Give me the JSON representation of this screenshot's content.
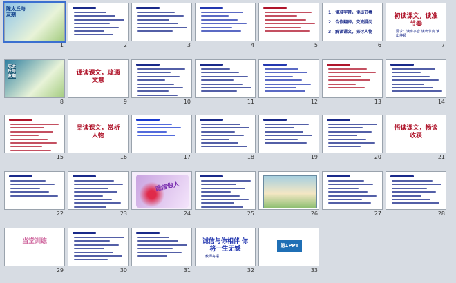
{
  "slides": [
    {
      "n": "1",
      "kind": "cover",
      "title": "陈太丘与友期",
      "bg": "#8fc3e8"
    },
    {
      "n": "2",
      "kind": "text",
      "title": "",
      "lines": 7,
      "ink": "#1a2a8a"
    },
    {
      "n": "3",
      "kind": "text",
      "title": "",
      "lines": 6,
      "ink": "#1a2a8a"
    },
    {
      "n": "4",
      "kind": "vocab",
      "title": "",
      "ink": "#2438b0"
    },
    {
      "n": "5",
      "kind": "text",
      "title": "",
      "lines": 6,
      "ink": "#b0162c"
    },
    {
      "n": "6",
      "kind": "list",
      "items": [
        "1．读准字音，读出节奏",
        "2．合作翻译，交流疑问",
        "3．解读课文，探讨人物"
      ],
      "ink": "#1a2a8a"
    },
    {
      "n": "7",
      "kind": "heading",
      "title": "初读课文，读准节奏",
      "ink": "#b0162c",
      "sub": "要求：读准字音 读出节奏 读出停顿"
    },
    {
      "n": "8",
      "kind": "cover2",
      "title": "陈太丘与友期",
      "bg": "#2f7fa0"
    },
    {
      "n": "9",
      "kind": "heading",
      "title": "译读课文，疏通文意",
      "ink": "#b0162c",
      "sub": ""
    },
    {
      "n": "10",
      "kind": "text",
      "title": "",
      "lines": 8,
      "ink": "#1a2a8a"
    },
    {
      "n": "11",
      "kind": "text",
      "title": "",
      "lines": 7,
      "ink": "#1a2a8a"
    },
    {
      "n": "12",
      "kind": "text",
      "title": "",
      "lines": 7,
      "ink": "#2438b0"
    },
    {
      "n": "13",
      "kind": "text",
      "title": "",
      "lines": 6,
      "ink": "#b0162c"
    },
    {
      "n": "14",
      "kind": "text",
      "title": "",
      "lines": 7,
      "ink": "#1a2a8a"
    },
    {
      "n": "15",
      "kind": "text",
      "title": "",
      "lines": 8,
      "ink": "#b0162c"
    },
    {
      "n": "16",
      "kind": "heading",
      "title": "品读课文，赏析人物",
      "ink": "#b0162c",
      "sub": ""
    },
    {
      "n": "17",
      "kind": "text",
      "title": "",
      "lines": 4,
      "ink": "#1a3ad0"
    },
    {
      "n": "18",
      "kind": "text",
      "title": "",
      "lines": 7,
      "ink": "#1a2a8a"
    },
    {
      "n": "19",
      "kind": "text",
      "title": "",
      "lines": 6,
      "ink": "#1a2a8a"
    },
    {
      "n": "20",
      "kind": "text",
      "title": "",
      "lines": 7,
      "ink": "#1a2a8a"
    },
    {
      "n": "21",
      "kind": "heading",
      "title": "悟读课文，畅谈收获",
      "ink": "#b0162c",
      "sub": ""
    },
    {
      "n": "22",
      "kind": "text",
      "title": "",
      "lines": 5,
      "ink": "#1a2a8a"
    },
    {
      "n": "23",
      "kind": "text",
      "title": "",
      "lines": 8,
      "ink": "#1a2a8a"
    },
    {
      "n": "24",
      "kind": "art",
      "title": "诚信做人",
      "bg": "#c9a3e0"
    },
    {
      "n": "25",
      "kind": "text",
      "title": "",
      "lines": 8,
      "ink": "#1a2a8a"
    },
    {
      "n": "26",
      "kind": "picture",
      "title": "",
      "bg": "#a6cfe0"
    },
    {
      "n": "27",
      "kind": "text",
      "title": "",
      "lines": 7,
      "ink": "#1a2a8a"
    },
    {
      "n": "28",
      "kind": "text",
      "title": "",
      "lines": 7,
      "ink": "#1a2a8a"
    },
    {
      "n": "29",
      "kind": "heading",
      "title": "当堂训练",
      "ink": "#d06aa0",
      "sub": ""
    },
    {
      "n": "30",
      "kind": "text",
      "title": "",
      "lines": 7,
      "ink": "#1a2a8a"
    },
    {
      "n": "31",
      "kind": "text",
      "title": "",
      "lines": 6,
      "ink": "#1a2a8a"
    },
    {
      "n": "32",
      "kind": "heading",
      "title": "诚信与你相伴 你将一生无憾",
      "ink": "#2438b0",
      "sub": "教师寄语"
    },
    {
      "n": "33",
      "kind": "logo",
      "title": "第1PPT",
      "bg": "#ffffff"
    }
  ]
}
